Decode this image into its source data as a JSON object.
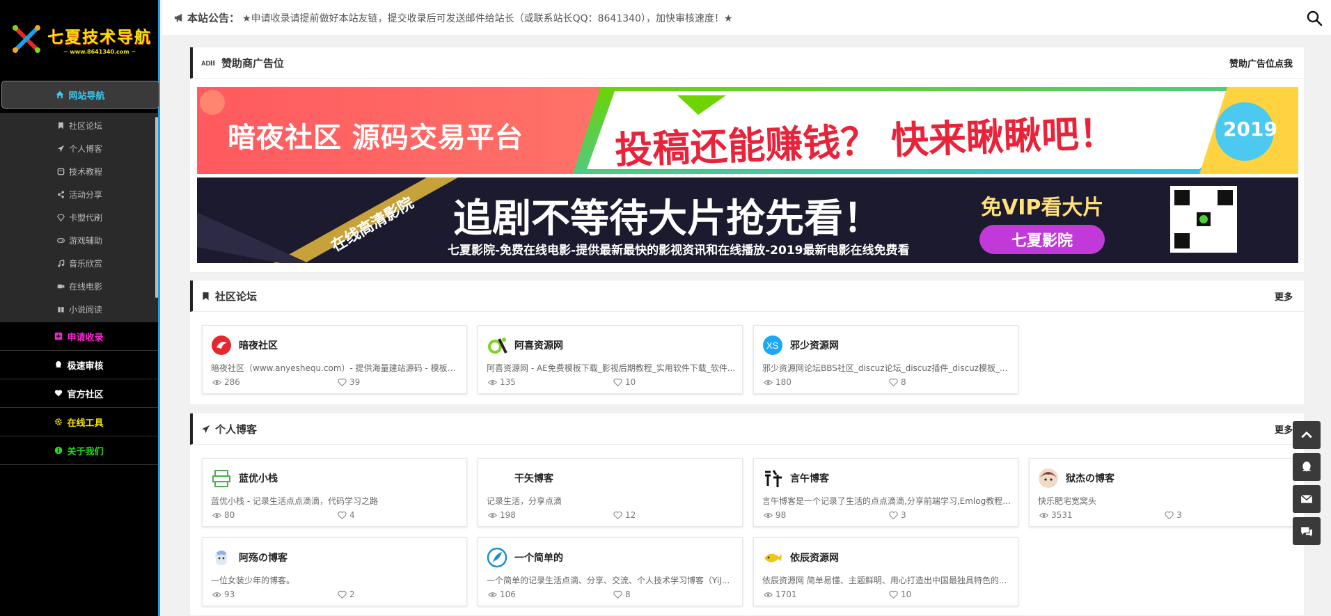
{
  "sidebar": {
    "logo_title": "七夏技术导航",
    "logo_sub": "~ www.8641340.com ~",
    "main_nav": {
      "label": "网站导航",
      "color": "#3ac9f0"
    },
    "sub_items": [
      {
        "label": "社区论坛",
        "icon": "bookmark-icon"
      },
      {
        "label": "个人博客",
        "icon": "paper-plane-icon"
      },
      {
        "label": "技术教程",
        "icon": "book-icon"
      },
      {
        "label": "活动分享",
        "icon": "share-icon"
      },
      {
        "label": "卡盟代刷",
        "icon": "diamond-icon"
      },
      {
        "label": "游戏辅助",
        "icon": "gamepad-icon"
      },
      {
        "label": "音乐欣赏",
        "icon": "music-icon"
      },
      {
        "label": "在线电影",
        "icon": "video-icon"
      },
      {
        "label": "小说阅读",
        "icon": "book-open-icon"
      }
    ],
    "menu_items": [
      {
        "label": "申请收录",
        "icon": "plus-square-icon",
        "color": "#ff1fd2"
      },
      {
        "label": "极速审核",
        "icon": "qq-icon",
        "color": "#ffffff"
      },
      {
        "label": "官方社区",
        "icon": "heart-icon",
        "color": "#ffffff"
      },
      {
        "label": "在线工具",
        "icon": "gear-icon",
        "color": "#f5e400"
      },
      {
        "label": "关于我们",
        "icon": "info-icon",
        "color": "#22e014"
      }
    ]
  },
  "topbar": {
    "notice_label": "本站公告：",
    "notice_text": "★申请收录请提前做好本站友链，提交收录后可发送邮件给站长（或联系站长QQ：8641340），加快审核速度！★"
  },
  "sponsor": {
    "title": "赞助商广告位",
    "more": "赞助广告位点我",
    "banner1": {
      "left": "暗夜社区 源码交易平台",
      "right": "投稿还能赚钱？ 快来瞅瞅吧！",
      "year": "2019"
    },
    "banner2": {
      "ribbon": "在线高清影院",
      "headline": "追剧不等待大片抢先看！",
      "vip": "免VIP看大片",
      "caption": "七夏影院-免费在线电影-提供最新最快的影视资讯和在线播放-2019最新电影在线免费看",
      "button": "七夏影院"
    }
  },
  "forum": {
    "title": "社区论坛",
    "more": "更多",
    "cards": [
      {
        "name": "暗夜社区",
        "desc": "暗夜社区（www.anyeshequ.com）- 提供海量建站源码 - 模板插件...",
        "views": "286",
        "likes": "39"
      },
      {
        "name": "阿喜资源网",
        "desc": "阿喜资源网 - AE免费模板下载_影视后期教程_实用软件下载_软件...",
        "views": "135",
        "likes": "10"
      },
      {
        "name": "邪少资源网",
        "desc": "邪少资源网论坛BBS社区_discuz论坛_discuz插件_discuz模板_...",
        "views": "180",
        "likes": "8"
      }
    ]
  },
  "blog": {
    "title": "个人博客",
    "more": "更多",
    "cards": [
      {
        "name": "蓝优小栈",
        "desc": "蓝优小栈 - 记录生活点点滴滴，代码学习之路",
        "views": "80",
        "likes": "4"
      },
      {
        "name": "干矢博客",
        "desc": "记录生活，分享点滴",
        "views": "198",
        "likes": "12"
      },
      {
        "name": "言午博客",
        "desc": "言午博客是一个记录了生活的点点滴滴,分享前端学习,Emlog教程...",
        "views": "98",
        "likes": "3"
      },
      {
        "name": "狱杰の博客",
        "desc": "快乐肥宅宽窝头",
        "views": "3531",
        "likes": "3"
      },
      {
        "name": "阿殇の博客",
        "desc": "一位女装少年的博客。",
        "views": "93",
        "likes": "2"
      },
      {
        "name": "一个简单的",
        "desc": "一个简单的记录生活点滴、分享、交流、个人技术学习博客（YiJ...",
        "views": "106",
        "likes": "8"
      },
      {
        "name": "依辰资源网",
        "desc": "依辰资源网 简单易懂、主题鲜明、用心打造出中国最独具特色的...",
        "views": "1701",
        "likes": "10"
      }
    ]
  },
  "float_buttons": [
    "arrow-up-icon",
    "qq-icon",
    "mail-icon",
    "chat-icon"
  ]
}
